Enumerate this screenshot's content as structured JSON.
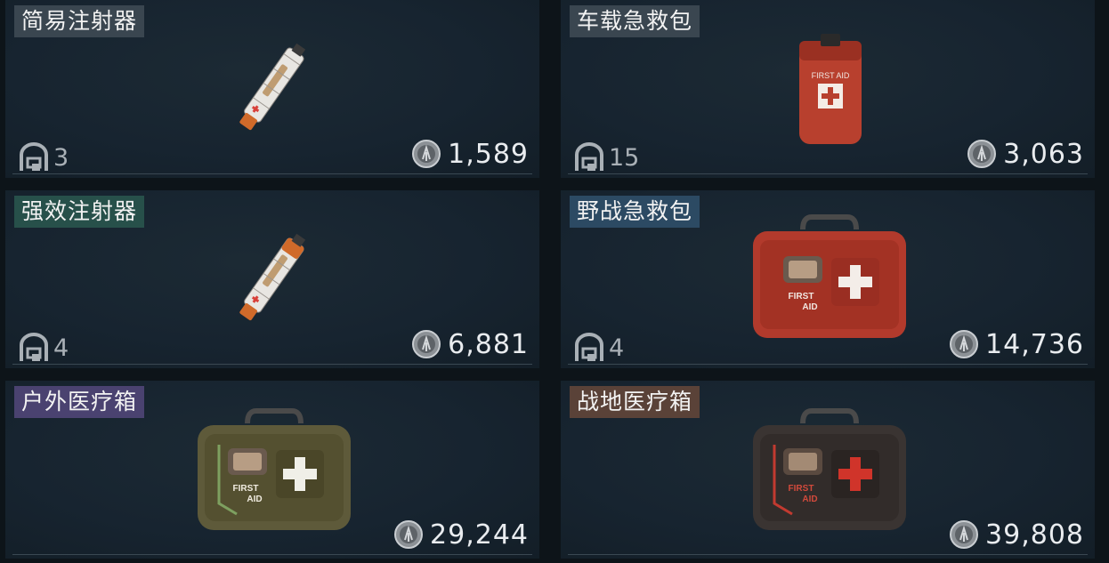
{
  "items": [
    {
      "name": "简易注射器",
      "weight": "3",
      "price": "1,589",
      "tag_color": "#3a4650",
      "art": "syringe-white"
    },
    {
      "name": "车载急救包",
      "weight": "15",
      "price": "3,063",
      "tag_color": "#3a4650",
      "art": "pouch-red"
    },
    {
      "name": "强效注射器",
      "weight": "4",
      "price": "6,881",
      "tag_color": "#27504a",
      "art": "syringe-orange"
    },
    {
      "name": "野战急救包",
      "weight": "4",
      "price": "14,736",
      "tag_color": "#2c4a63",
      "art": "kit-red"
    },
    {
      "name": "户外医疗箱",
      "weight": "",
      "price": "29,244",
      "tag_color": "#4a4270",
      "art": "case-olive"
    },
    {
      "name": "战地医疗箱",
      "weight": "",
      "price": "39,808",
      "tag_color": "#5a4238",
      "art": "case-black"
    }
  ],
  "kit_label_1": "FIRST",
  "kit_label_2": "AID",
  "pouch_label": "FIRST AID"
}
